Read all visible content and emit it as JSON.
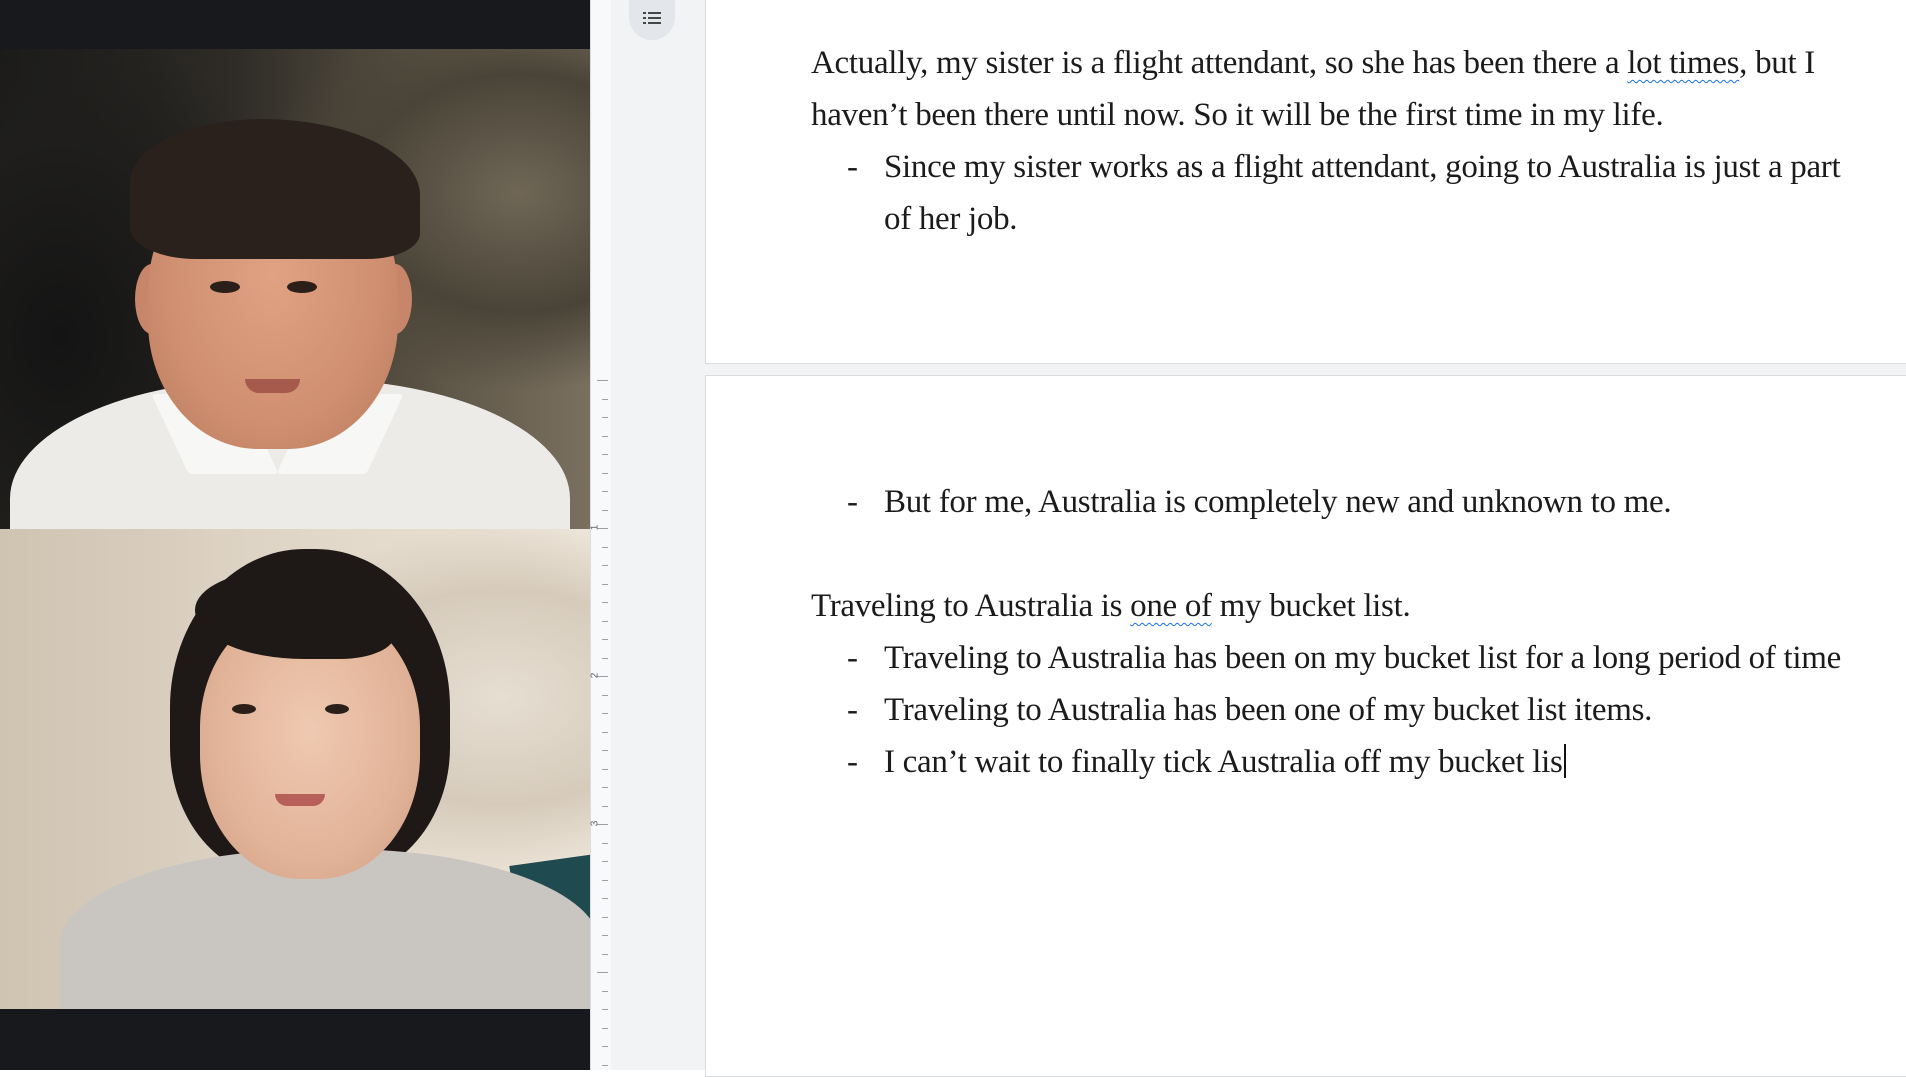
{
  "video_call": {
    "participants": [
      {
        "role": "tutor-video"
      },
      {
        "role": "student-video"
      }
    ]
  },
  "docs": {
    "outline_icon": "list-icon",
    "ruler_labels": [
      "1",
      "2",
      "3"
    ],
    "page1": {
      "para1_part_a": "Actually, my sister is a flight attendant, so she has been there a ",
      "para1_squiggle": "lot times",
      "para1_part_b": ", but I",
      "para1_line2": "haven’t been there until now. So it will be the first time in my life.",
      "bullet_marker": "-",
      "bullet1_line1": "Since my sister works as a flight attendant, going to Australia is just a part",
      "bullet1_line2": "of her job."
    },
    "page2": {
      "bullet_marker": "-",
      "bullet2": "But for me, Australia is completely new and unknown to me.",
      "para2_part_a": "Traveling to Australia is ",
      "para2_squiggle": "one of",
      "para2_part_b": " my bucket list.",
      "bullet3": "Traveling to Australia has been on my bucket list for a long period of time",
      "bullet4": "Traveling to Australia has been one of my bucket list items.",
      "bullet5": "I can’t wait to finally tick Australia off my bucket lis"
    }
  },
  "colors": {
    "video_bg": "#17191c",
    "canvas_bg": "#f1f3f4",
    "spellcheck": "#1a73e8",
    "text": "#1b1b1b"
  }
}
